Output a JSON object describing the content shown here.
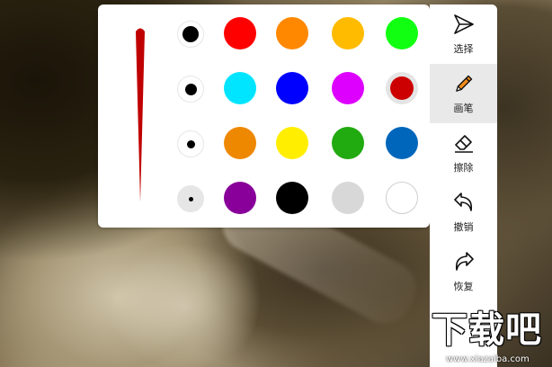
{
  "palette": {
    "brush_preview_color": "#c00000",
    "sizes": [
      {
        "name": "size-large",
        "dot": 18,
        "selected": false
      },
      {
        "name": "size-medium",
        "dot": 13,
        "selected": false
      },
      {
        "name": "size-small",
        "dot": 9,
        "selected": false
      },
      {
        "name": "size-tiny",
        "dot": 5,
        "selected": true
      }
    ],
    "colors": [
      [
        "#ff0000",
        "#ff8800",
        "#ffbb00",
        "#11ff11"
      ],
      [
        "#00e5ff",
        "#0000ff",
        "#dd00ff",
        "#cc0000"
      ],
      [
        "#ee8800",
        "#ffee00",
        "#22aa11",
        "#0066bb"
      ],
      [
        "#880099",
        "#000000",
        "#d8d8d8",
        "#ffffff"
      ]
    ],
    "selected_color": "#cc0000"
  },
  "toolbar": {
    "select_label": "选择",
    "pen_label": "画笔",
    "eraser_label": "擦除",
    "undo_label": "撤销",
    "redo_label": "恢复",
    "active_tool": "pen"
  },
  "watermark": {
    "title": "下载吧",
    "url": "www.xiazaiba.com"
  }
}
